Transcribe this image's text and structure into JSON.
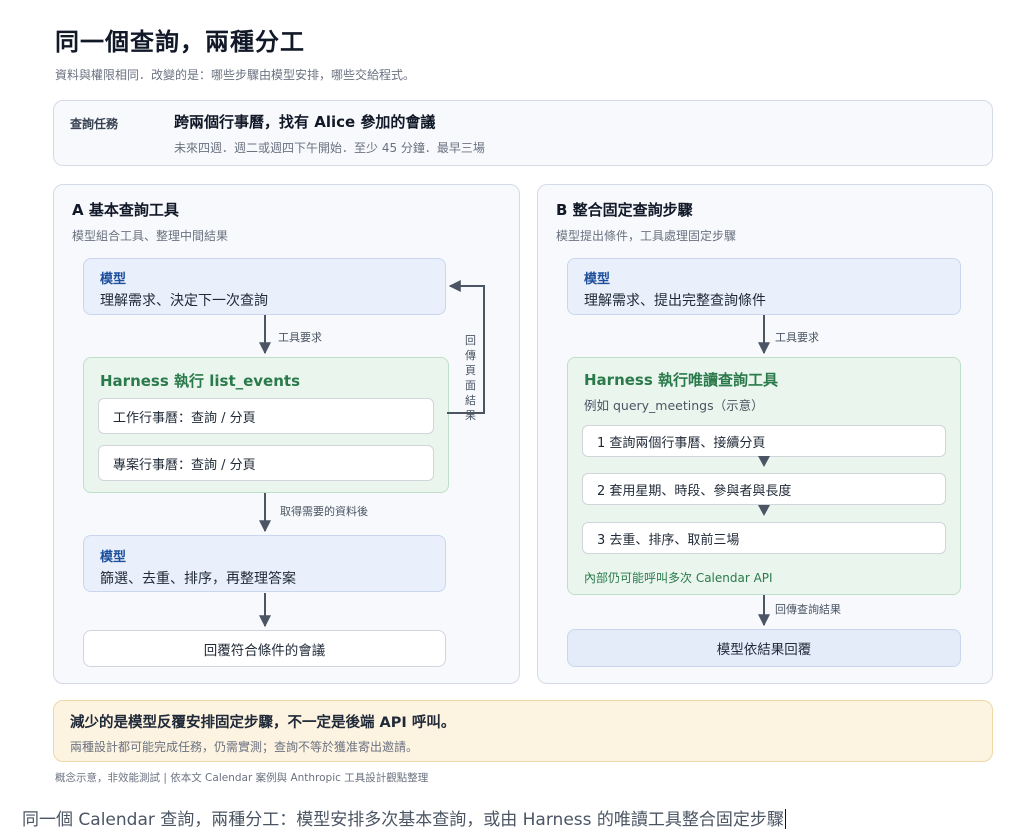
{
  "header": {
    "title": "同一個查詢，兩種分工",
    "subtitle": "資料與權限相同．改變的是：哪些步驟由模型安排，哪些交給程式。"
  },
  "task": {
    "label": "查詢任務",
    "title": "跨兩個行事曆，找有 Alice 參加的會議",
    "detail": "未來四週．週二或週四下午開始．至少 45 分鐘．最早三場"
  },
  "panel_a": {
    "title": "A 基本查詢工具",
    "subtitle": "模型組合工具、整理中間結果",
    "model1": {
      "head": "模型",
      "body": "理解需求、決定下一次查詢"
    },
    "arrow1_label": "工具要求",
    "return_label": [
      "回傳",
      "頁面",
      "結果"
    ],
    "harness": {
      "title": "Harness 執行 list_events",
      "items": [
        "工作行事曆：查詢 / 分頁",
        "專案行事曆：查詢 / 分頁"
      ]
    },
    "arrow2_label": "取得需要的資料後",
    "model2": {
      "head": "模型",
      "body": "篩選、去重、排序，再整理答案"
    },
    "result": "回覆符合條件的會議"
  },
  "panel_b": {
    "title": "B 整合固定查詢步驟",
    "subtitle": "模型提出條件，工具處理固定步驟",
    "model1": {
      "head": "模型",
      "body": "理解需求、提出完整查詢條件"
    },
    "arrow1_label": "工具要求",
    "harness": {
      "title": "Harness 執行唯讀查詢工具",
      "subtitle": "例如 query_meetings（示意）",
      "steps": [
        "1 查詢兩個行事曆、接續分頁",
        "2 套用星期、時段、參與者與長度",
        "3 去重、排序、取前三場"
      ],
      "note": "內部仍可能呼叫多次 Calendar API"
    },
    "arrow2_label": "回傳查詢結果",
    "result": "模型依結果回覆"
  },
  "callout": {
    "title": "減少的是模型反覆安排固定步驟，不一定是後端 API 呼叫。",
    "body": "兩種設計都可能完成任務，仍需實測；查詢不等於獲准寄出邀請。"
  },
  "footnote": "概念示意，非效能測試 | 依本文 Calendar 案例與 Anthropic 工具設計觀點整理",
  "caption": "同一個 Calendar 查詢，兩種分工：模型安排多次基本查詢，或由 Harness 的唯讀工具整合固定步驟",
  "colors": {
    "model_fill": "#e9effb",
    "harness_fill": "#eaf5ee",
    "callout_fill": "#fdf3e1",
    "arrow": "#4b5563",
    "harness_title": "#2b7a4b",
    "model_head": "#1d4f9c"
  }
}
